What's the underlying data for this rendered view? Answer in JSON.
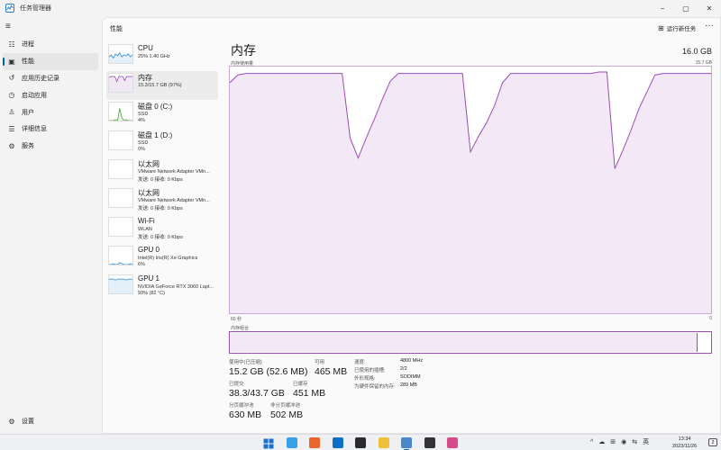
{
  "window": {
    "title": "任务管理器",
    "icon": "task-manager-icon",
    "controls": {
      "minimize": "−",
      "maximize": "▢",
      "close": "✕"
    }
  },
  "nav": {
    "menu_icon": "≡",
    "items": [
      {
        "label": "进程",
        "icon": "☷",
        "icon_name": "processes-icon",
        "active": false
      },
      {
        "label": "性能",
        "icon": "▣",
        "icon_name": "performance-icon",
        "active": true
      },
      {
        "label": "应用历史记录",
        "icon": "↺",
        "icon_name": "history-icon",
        "active": false
      },
      {
        "label": "启动应用",
        "icon": "◷",
        "icon_name": "startup-icon",
        "active": false
      },
      {
        "label": "用户",
        "icon": "♙",
        "icon_name": "users-icon",
        "active": false
      },
      {
        "label": "详细信息",
        "icon": "☰",
        "icon_name": "details-icon",
        "active": false
      },
      {
        "label": "服务",
        "icon": "⚙",
        "icon_name": "services-icon",
        "active": false
      }
    ],
    "settings": {
      "label": "设置",
      "icon": "⚙"
    }
  },
  "header": {
    "section_title": "性能",
    "run_task_icon": "⊞",
    "run_task_label": "运行新任务",
    "more_label": "···"
  },
  "devices": [
    {
      "name": "CPU",
      "line1": "25% 1.40 GHz",
      "line2": "",
      "color": "#1783d6",
      "active": false
    },
    {
      "name": "内存",
      "line1": "15.3/15.7 GB (97%)",
      "line2": "",
      "color": "#8f3fb3",
      "active": true
    },
    {
      "name": "磁盘 0 (C:)",
      "line1": "SSD",
      "line2": "4%",
      "color": "#4b9b2f",
      "active": false
    },
    {
      "name": "磁盘 1 (D:)",
      "line1": "SSD",
      "line2": "0%",
      "color": "#4b9b2f",
      "active": false
    },
    {
      "name": "以太网",
      "line1": "VMware Network Adapter VMn...",
      "line2": "发送: 0 接收: 0 Kbps",
      "color": "#c06a0d",
      "active": false
    },
    {
      "name": "以太网",
      "line1": "VMware Network Adapter VMn...",
      "line2": "发送: 0 接收: 0 Kbps",
      "color": "#c06a0d",
      "active": false
    },
    {
      "name": "Wi-Fi",
      "line1": "WLAN",
      "line2": "发送: 0 接收: 0 Kbps",
      "color": "#c06a0d",
      "active": false
    },
    {
      "name": "GPU 0",
      "line1": "Intel(R) Iris(R) Xe Graphics",
      "line2": "6%",
      "color": "#1783d6",
      "active": false
    },
    {
      "name": "GPU 1",
      "line1": "NVIDIA GeForce RTX 3060 Lapt...",
      "line2": "93% (82 °C)",
      "color": "#1783d6",
      "active": false
    }
  ],
  "memory": {
    "title": "内存",
    "total": "16.0 GB",
    "usage_label": "内存使用量",
    "usage_max": "15.7 GB",
    "time_left": "60 秒",
    "time_right": "0",
    "composition_label": "内存组合",
    "in_use_label": "使用中(已压缩)",
    "in_use_value": "15.2 GB (52.6 MB)",
    "available_label": "可用",
    "available_value": "465 MB",
    "committed_label": "已提交",
    "committed_value": "38.3/43.7 GB",
    "cached_label": "已缓存",
    "cached_value": "451 MB",
    "paged_label": "分页缓冲池",
    "paged_value": "630 MB",
    "nonpaged_label": "非分页缓冲池",
    "nonpaged_value": "502 MB",
    "props": [
      {
        "label": "速度:",
        "value": "4800 MHz"
      },
      {
        "label": "已使用的插槽:",
        "value": "2/2"
      },
      {
        "label": "外形规格:",
        "value": "SODIMM"
      },
      {
        "label": "为硬件保留的内存:",
        "value": "289 MB"
      }
    ],
    "color": "#9a4cb8",
    "fill_color": "#f3e8f6",
    "composition_in_use_pct": 97
  },
  "chart_data": {
    "type": "area",
    "title": "",
    "x": [
      60,
      59,
      58,
      57,
      56,
      55,
      54,
      53,
      52,
      51,
      50,
      49,
      48,
      47,
      46,
      45,
      44,
      43,
      42,
      41,
      40,
      39,
      38,
      37,
      36,
      35,
      34,
      33,
      32,
      31,
      30,
      29,
      28,
      27,
      26,
      25,
      24,
      23,
      22,
      21,
      20,
      19,
      18,
      17,
      16,
      15,
      14,
      13,
      12,
      11,
      10,
      9,
      8,
      7,
      6,
      5,
      4,
      3,
      2,
      1,
      0
    ],
    "values": [
      15.0,
      15.5,
      15.6,
      15.6,
      15.6,
      15.6,
      15.6,
      15.6,
      15.6,
      15.6,
      15.6,
      15.6,
      15.6,
      15.6,
      15.6,
      11.4,
      10.1,
      11.4,
      12.6,
      13.9,
      15.1,
      15.6,
      15.6,
      15.6,
      15.6,
      15.6,
      15.6,
      15.6,
      15.6,
      15.6,
      10.5,
      11.5,
      12.4,
      13.5,
      15.0,
      15.6,
      15.6,
      15.6,
      15.6,
      15.6,
      15.6,
      15.6,
      15.6,
      15.6,
      15.6,
      15.6,
      15.7,
      15.7,
      9.4,
      10.6,
      11.9,
      13.3,
      14.4,
      15.5,
      15.6,
      15.6,
      15.6,
      15.6,
      15.6,
      15.6,
      15.6
    ],
    "xlabel": "",
    "ylabel": "",
    "xlim": [
      60,
      0
    ],
    "ylim": [
      0,
      15.7
    ],
    "grid": false
  },
  "taskbar": {
    "apps": [
      {
        "name": "start-icon",
        "color": "#1b6fd1"
      },
      {
        "name": "copilot-icon",
        "color": "#3aa0e6"
      },
      {
        "name": "firefox-icon",
        "color": "#e8662a"
      },
      {
        "name": "edge-icon",
        "color": "#0f6fc6"
      },
      {
        "name": "terminal-icon",
        "color": "#2b2b2b"
      },
      {
        "name": "file-explorer-icon",
        "color": "#f0c03a"
      },
      {
        "name": "task-manager-app-icon",
        "color": "#4a86c8"
      },
      {
        "name": "cmd-icon",
        "color": "#333333"
      },
      {
        "name": "snipping-icon",
        "color": "#d64a8a"
      }
    ],
    "tray": [
      "^",
      "☁",
      "⊞",
      "◉",
      "⇆",
      "英"
    ],
    "time": "13:34",
    "date": "2023/11/26",
    "notifications": "2"
  }
}
